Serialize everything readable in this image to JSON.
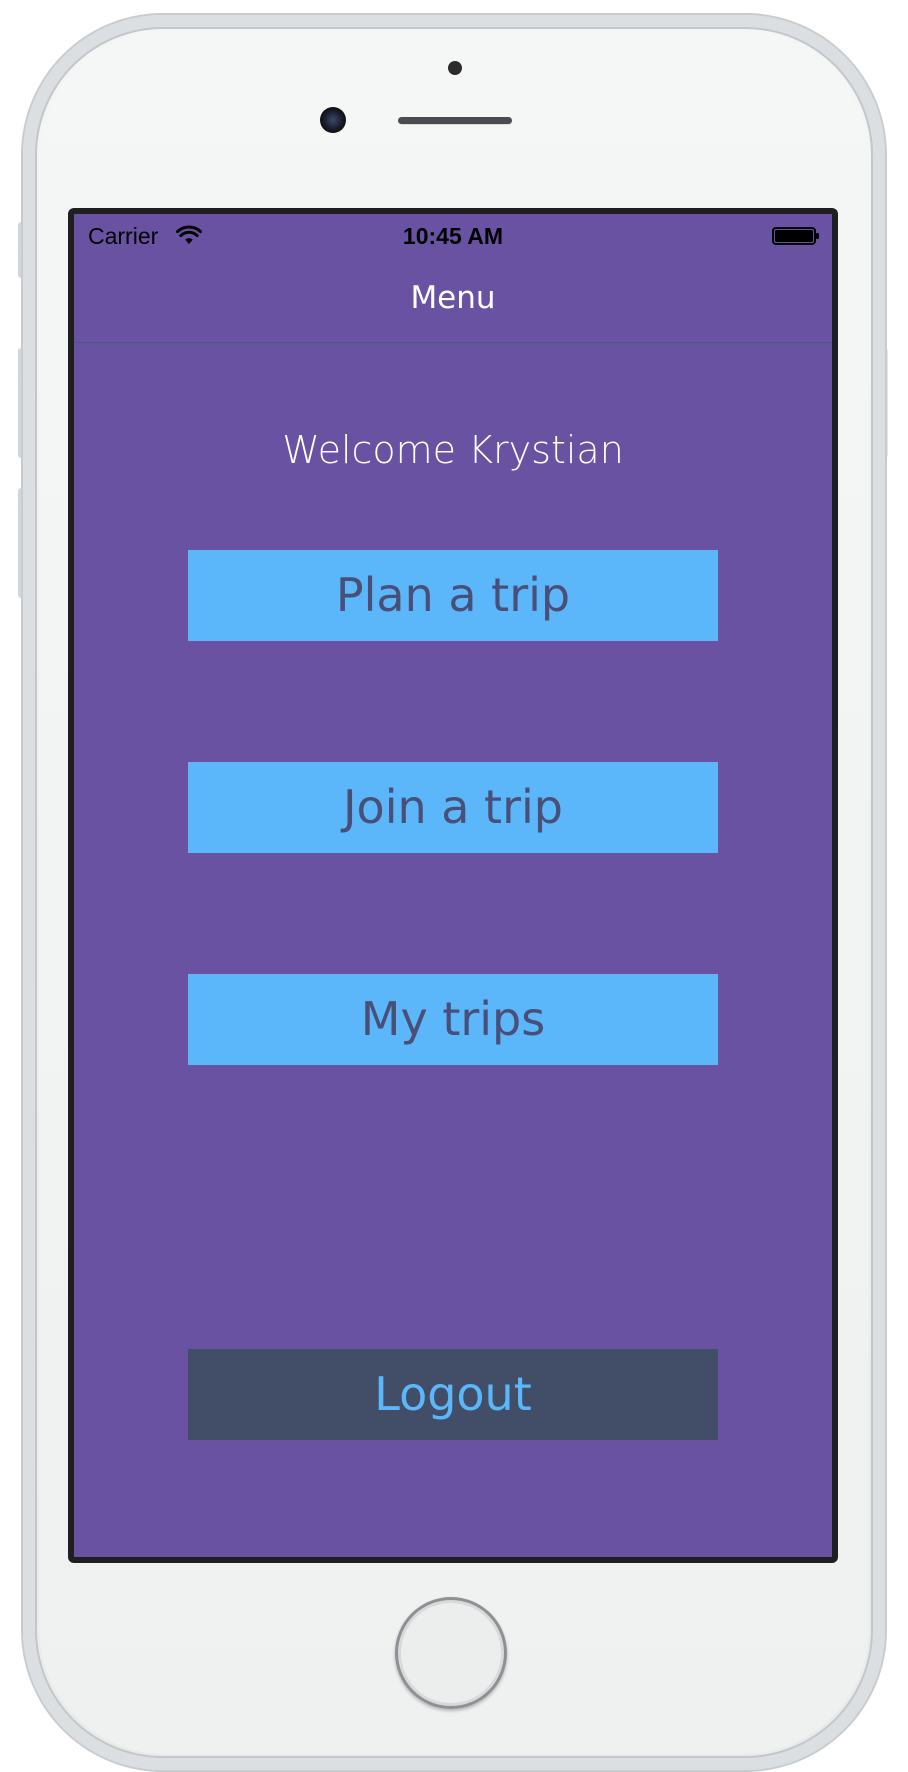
{
  "status_bar": {
    "carrier": "Carrier",
    "time": "10:45 AM",
    "wifi_icon": "wifi-icon",
    "battery_icon": "battery-icon"
  },
  "nav": {
    "title": "Menu"
  },
  "main": {
    "welcome": "Welcome Krystian",
    "buttons": {
      "plan": "Plan a trip",
      "join": "Join a trip",
      "my_trips": "My trips",
      "logout": "Logout"
    }
  },
  "colors": {
    "background": "#6852a1",
    "primary_button": "#5bb6fa",
    "primary_button_text": "#4a4f78",
    "logout_button": "#424e68",
    "logout_button_text": "#5bb6fa"
  }
}
